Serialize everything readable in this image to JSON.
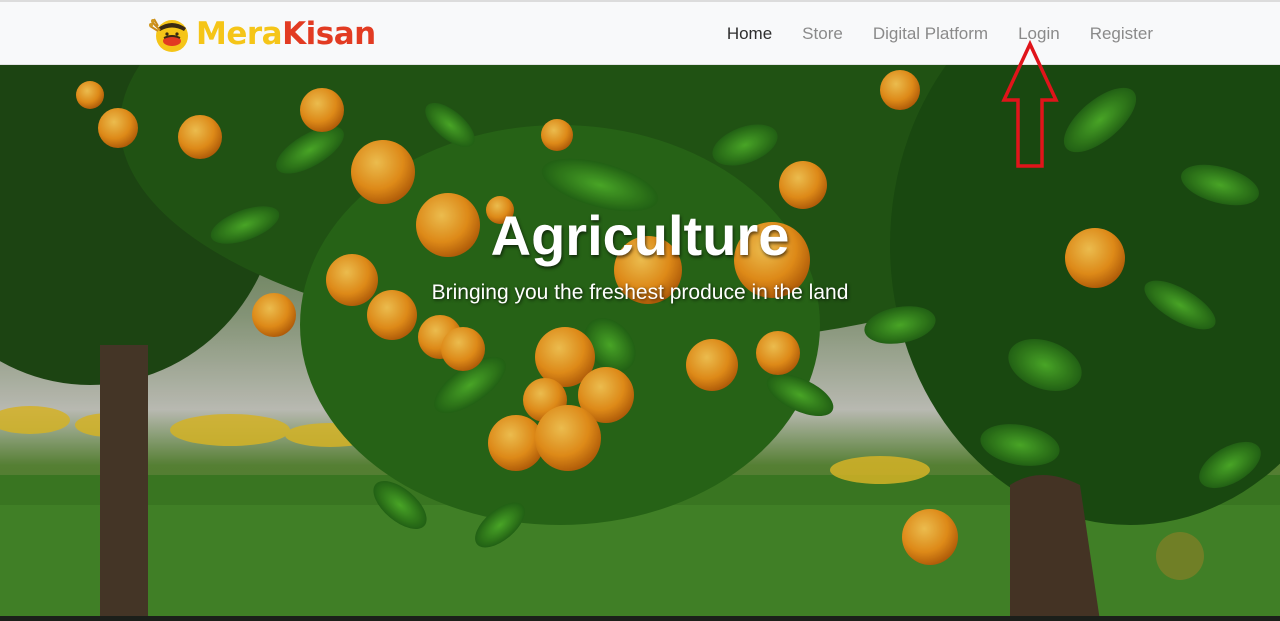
{
  "brand": {
    "name_part1": "Mera",
    "name_part2": "Kisan",
    "logo_icon": "farmer-logo-icon"
  },
  "nav": {
    "items": [
      {
        "label": "Home",
        "active": true
      },
      {
        "label": "Store",
        "active": false
      },
      {
        "label": "Digital Platform",
        "active": false
      },
      {
        "label": "Login",
        "active": false
      },
      {
        "label": "Register",
        "active": false
      }
    ]
  },
  "hero": {
    "title": "Agriculture",
    "subtitle": "Bringing you the freshest produce in the land",
    "background": "orange-tree-photo"
  },
  "annotation": {
    "icon": "red-up-arrow-icon",
    "color": "#e0141a"
  },
  "colors": {
    "brand_yellow": "#f5c518",
    "brand_red": "#e23b22",
    "nav_active": "#2e2e2e",
    "nav_inactive": "#8a8a8a"
  }
}
